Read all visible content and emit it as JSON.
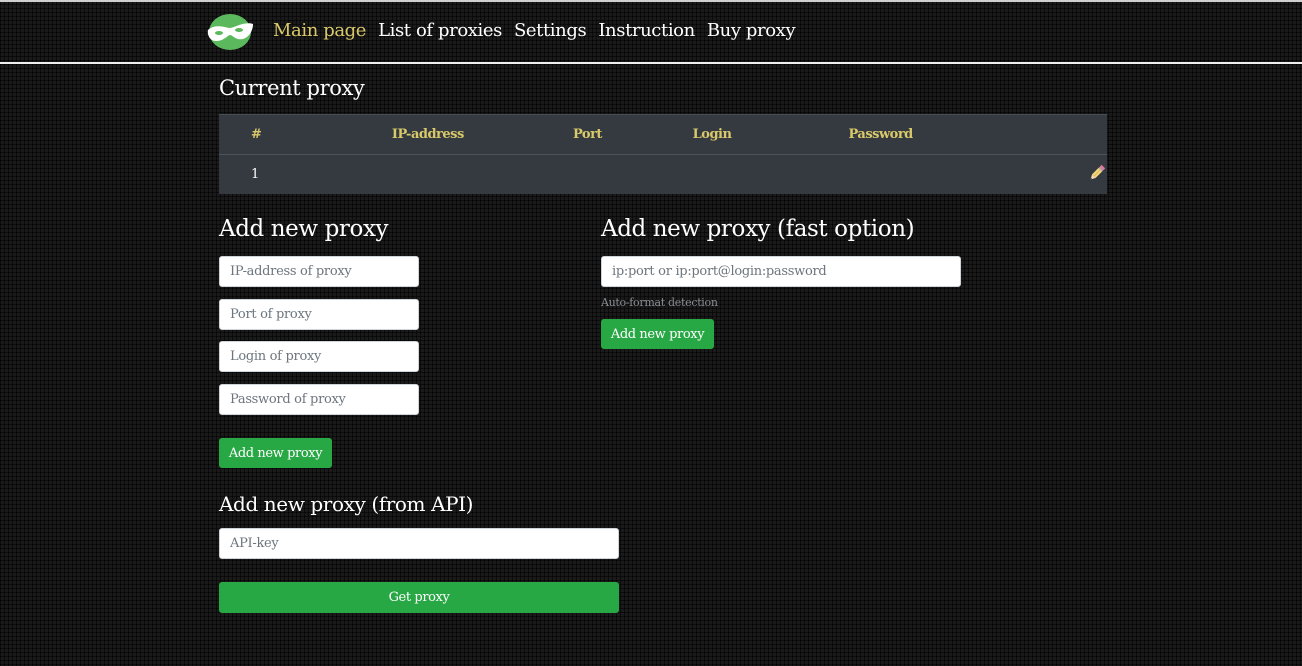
{
  "nav": {
    "logo_icon": "mask-logo-icon",
    "links": [
      {
        "label": "Main page",
        "active": true
      },
      {
        "label": "List of proxies",
        "active": false
      },
      {
        "label": "Settings",
        "active": false
      },
      {
        "label": "Instruction",
        "active": false
      },
      {
        "label": "Buy proxy",
        "active": false
      }
    ]
  },
  "current_proxy": {
    "title": "Current proxy",
    "columns": [
      "#",
      "IP-address",
      "Port",
      "Login",
      "Password",
      ""
    ],
    "rows": [
      {
        "num": "1",
        "ip": "",
        "port": "",
        "login": "",
        "password": "",
        "action_icon": "pencil-icon"
      }
    ]
  },
  "add_proxy": {
    "title": "Add new proxy",
    "ip_placeholder": "IP-address of proxy",
    "port_placeholder": "Port of proxy",
    "login_placeholder": "Login of proxy",
    "password_placeholder": "Password of proxy",
    "button_label": "Add new proxy"
  },
  "fast_option": {
    "title": "Add new proxy (fast option)",
    "placeholder": "ip:port or ip:port@login:password",
    "hint": "Auto-format detection",
    "button_label": "Add new proxy"
  },
  "api_option": {
    "title": "Add new proxy (from API)",
    "placeholder": "API-key",
    "button_label": "Get proxy"
  },
  "colors": {
    "accent_text": "#d9c96a",
    "button_green": "#28a745",
    "table_bg": "#343a40",
    "logo_green": "#5cb85c"
  }
}
